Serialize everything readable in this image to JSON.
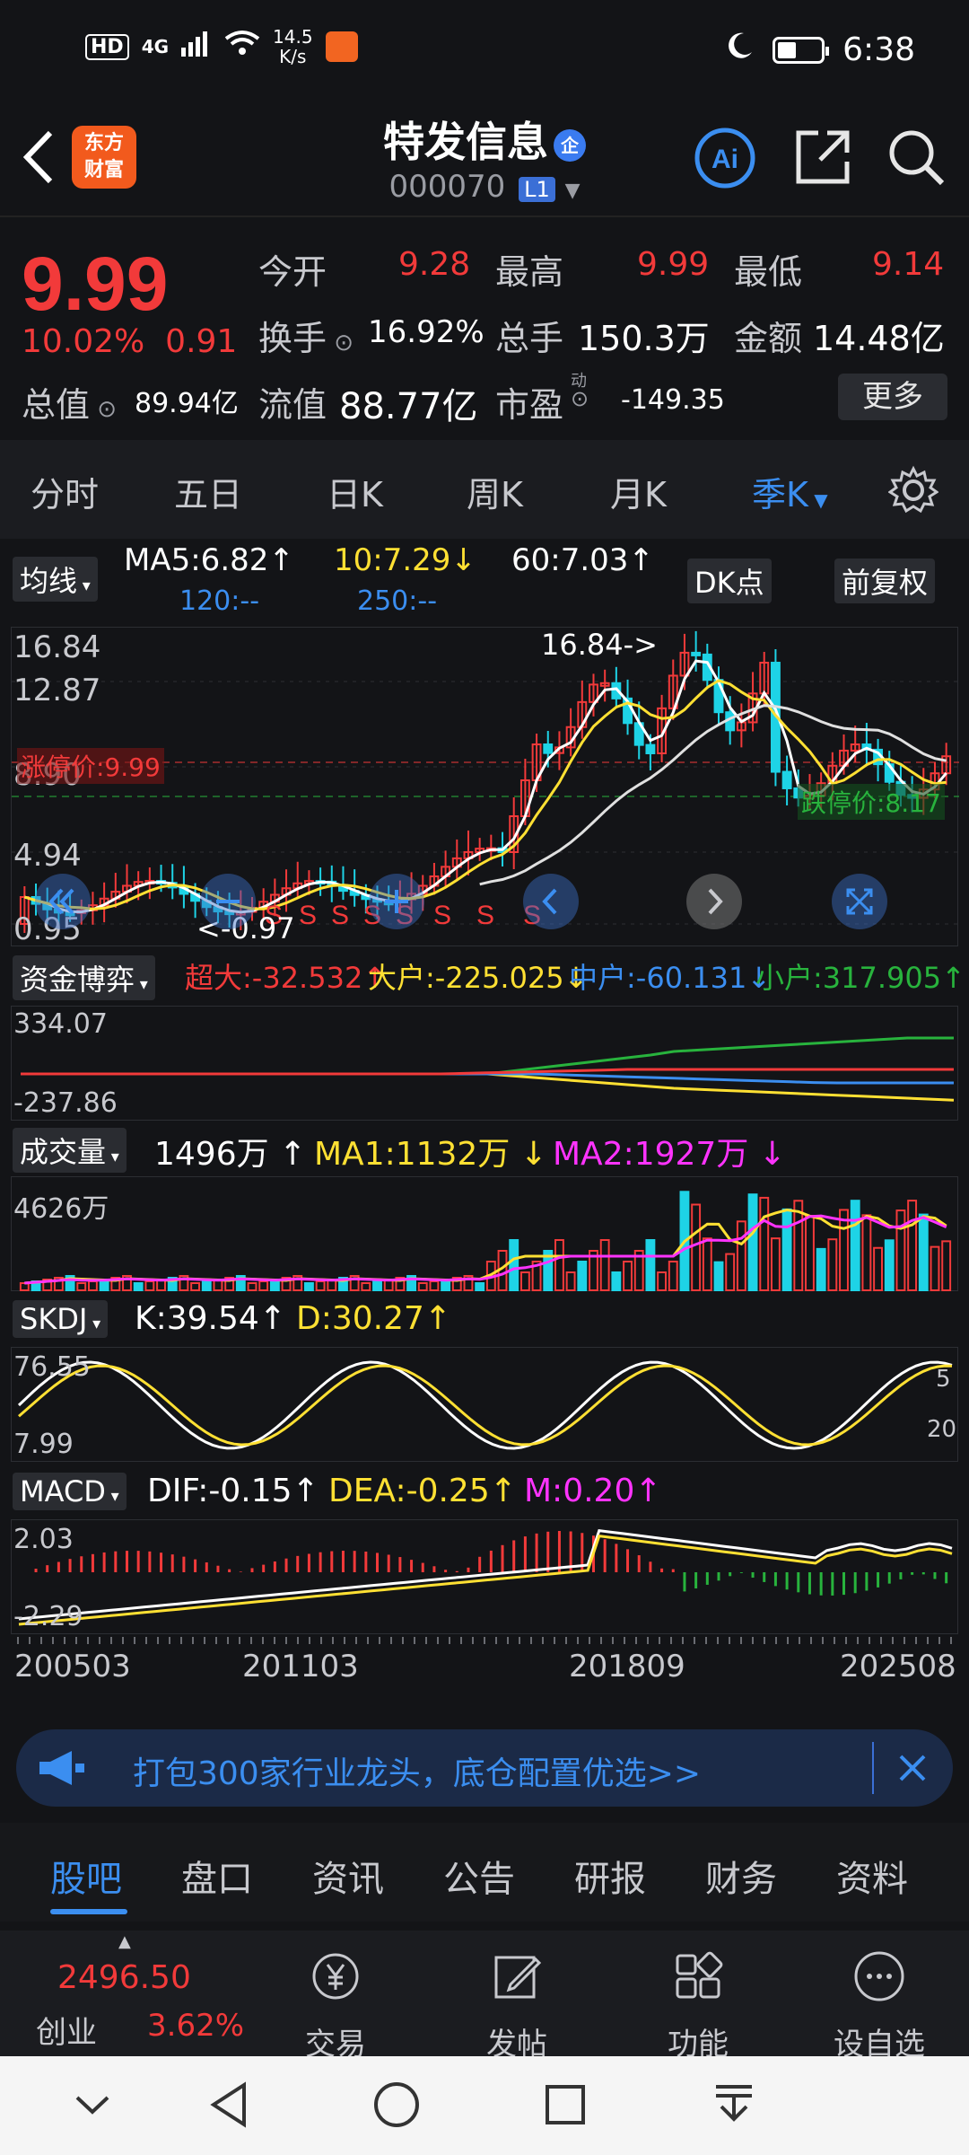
{
  "status_bar": {
    "network": "4G",
    "speed_value": "14.5",
    "speed_unit": "K/s",
    "time": "6:38"
  },
  "header": {
    "logo_line1": "东方",
    "logo_line2": "财富",
    "stock_name": "特发信息",
    "badge": "企",
    "code": "000070",
    "level": "L1",
    "ai_label": "Ai"
  },
  "quote": {
    "price": "9.99",
    "change_pct": "10.02%",
    "change_amt": "0.91",
    "open_label": "今开",
    "open": "9.28",
    "high_label": "最高",
    "high": "9.99",
    "low_label": "最低",
    "low": "9.14",
    "turnover_label": "换手",
    "turnover": "16.92%",
    "volume_label": "总手",
    "volume": "150.3万",
    "amount_label": "金额",
    "amount": "14.48亿",
    "mcap_label": "总值",
    "mcap": "89.94亿",
    "float_label": "流值",
    "float_cap": "88.77亿",
    "pe_label": "市盈",
    "pe_sup": "动",
    "pe": "-149.35",
    "more": "更多"
  },
  "periods": [
    "分时",
    "五日",
    "日K",
    "周K",
    "月K",
    "季K"
  ],
  "active_period": "季K",
  "ma_bar": {
    "button": "均线",
    "ma5": "MA5:6.82",
    "ma10": "10:7.29",
    "ma60": "60:7.03",
    "ma120": "120:--",
    "ma250": "250:--",
    "dk": "DK点",
    "adjust": "前复权"
  },
  "kline": {
    "y_labels": [
      "16.84",
      "12.87",
      "8.90",
      "4.94",
      "0.95"
    ],
    "max_label": "16.84->",
    "min_label": "<-0.97",
    "limit_up": "涨停价:9.99",
    "limit_down": "跌停价:8.17",
    "signal": "S"
  },
  "capital_bar": {
    "button": "资金博弈",
    "super": "超大:-32.532",
    "big": "大户:-225.025",
    "mid": "中户:-60.131",
    "small": "小户:317.905",
    "y_top": "334.07",
    "y_bottom": "-237.86"
  },
  "volume_bar": {
    "button": "成交量",
    "value": "1496万",
    "ma1": "MA1:1132万",
    "ma2": "MA2:1927万",
    "y_top": "4626万"
  },
  "skdj_bar": {
    "button": "SKDJ",
    "k": "K:39.54",
    "d": "D:30.27",
    "y_top": "76.55",
    "y_bottom": "7.99",
    "right_top": "5",
    "right_bottom": "20"
  },
  "macd_bar": {
    "button": "MACD",
    "dif": "DIF:-0.15",
    "dea": "DEA:-0.25",
    "m": "M:0.20",
    "y_top": "2.03",
    "y_bottom": "-2.29"
  },
  "x_axis": [
    "200503",
    "201103",
    "201809",
    "202508"
  ],
  "banner": {
    "text": "打包300家行业龙头，底仓配置优选>>"
  },
  "bottom_tabs": [
    "股吧",
    "盘口",
    "资讯",
    "公告",
    "研报",
    "财务",
    "资料"
  ],
  "toolbar": {
    "index_value": "2496.50",
    "index_name": "创业",
    "index_change": "3.62%",
    "trade": "交易",
    "post": "发帖",
    "functions": "功能",
    "watchlist": "设自选"
  },
  "colors": {
    "up": "#f23a3a",
    "down": "#28b33d",
    "accent": "#3b8ef0",
    "ma5": "#ffffff",
    "ma10": "#ffe033",
    "ma2": "#ff33ff"
  }
}
